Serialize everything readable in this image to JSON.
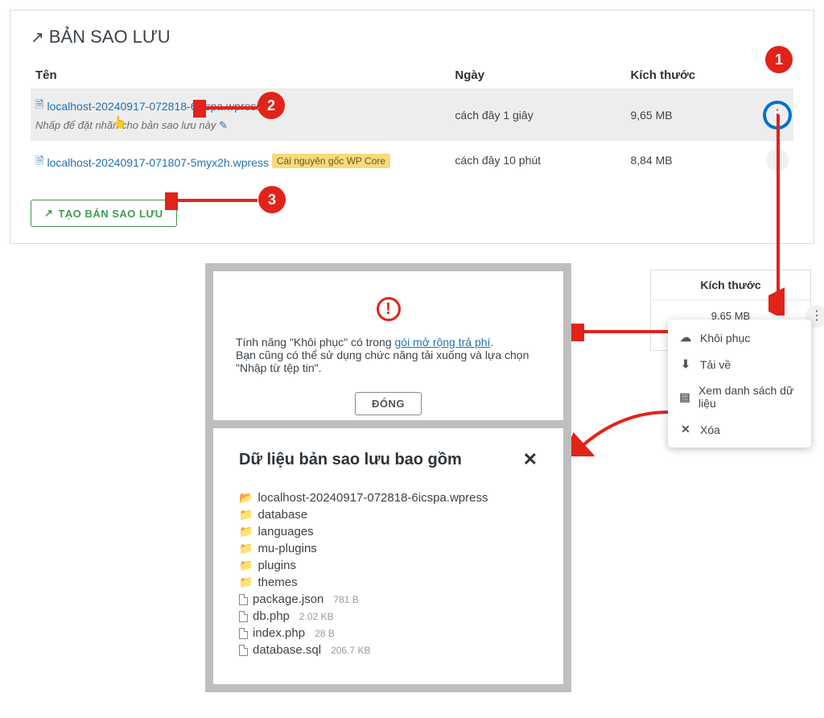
{
  "panel": {
    "title": "BẢN SAO LƯU",
    "headers": {
      "name": "Tên",
      "date": "Ngày",
      "size": "Kích thước"
    },
    "rows": [
      {
        "filename": "localhost-20240917-072818-6icspa.wpress",
        "label_prompt": "Nhấp để đặt nhãn cho bản sao lưu này",
        "date": "cách đây 1 giây",
        "size": "9,65 MB",
        "highlighted": true
      },
      {
        "filename": "localhost-20240917-071807-5myx2h.wpress",
        "badge": "Cài nguyên gốc WP Core",
        "date": "cách đây 10 phút",
        "size": "8,84 MB"
      }
    ],
    "create_btn": "TẠO BẢN SAO LƯU"
  },
  "dialog_restore": {
    "line1_a": "Tính năng \"Khôi phục\" có trong ",
    "line1_link": "gói mở rộng trả phí",
    "line1_b": ".",
    "line2": "Bạn cũng có thể sử dụng chức năng tải xuống và lựa chọn \"Nhập từ tệp tin\".",
    "close": "ĐÓNG"
  },
  "mini": {
    "header": "Kích thước",
    "size": "9,65 MB"
  },
  "ctx": {
    "restore": "Khôi phục",
    "download": "Tải về",
    "view": "Xem danh sách dữ liệu",
    "delete": "Xóa"
  },
  "tree": {
    "title": "Dữ liệu bản sao lưu bao gồm",
    "root": "localhost-20240917-072818-6icspa.wpress",
    "folders": [
      "database",
      "languages",
      "mu-plugins",
      "plugins",
      "themes"
    ],
    "files": [
      {
        "name": "package.json",
        "size": "781 B"
      },
      {
        "name": "db.php",
        "size": "2.02 KB"
      },
      {
        "name": "index.php",
        "size": "28 B"
      },
      {
        "name": "database.sql",
        "size": "206.7 KB"
      }
    ]
  },
  "annotations": {
    "1": "1",
    "2": "2",
    "3": "3"
  }
}
